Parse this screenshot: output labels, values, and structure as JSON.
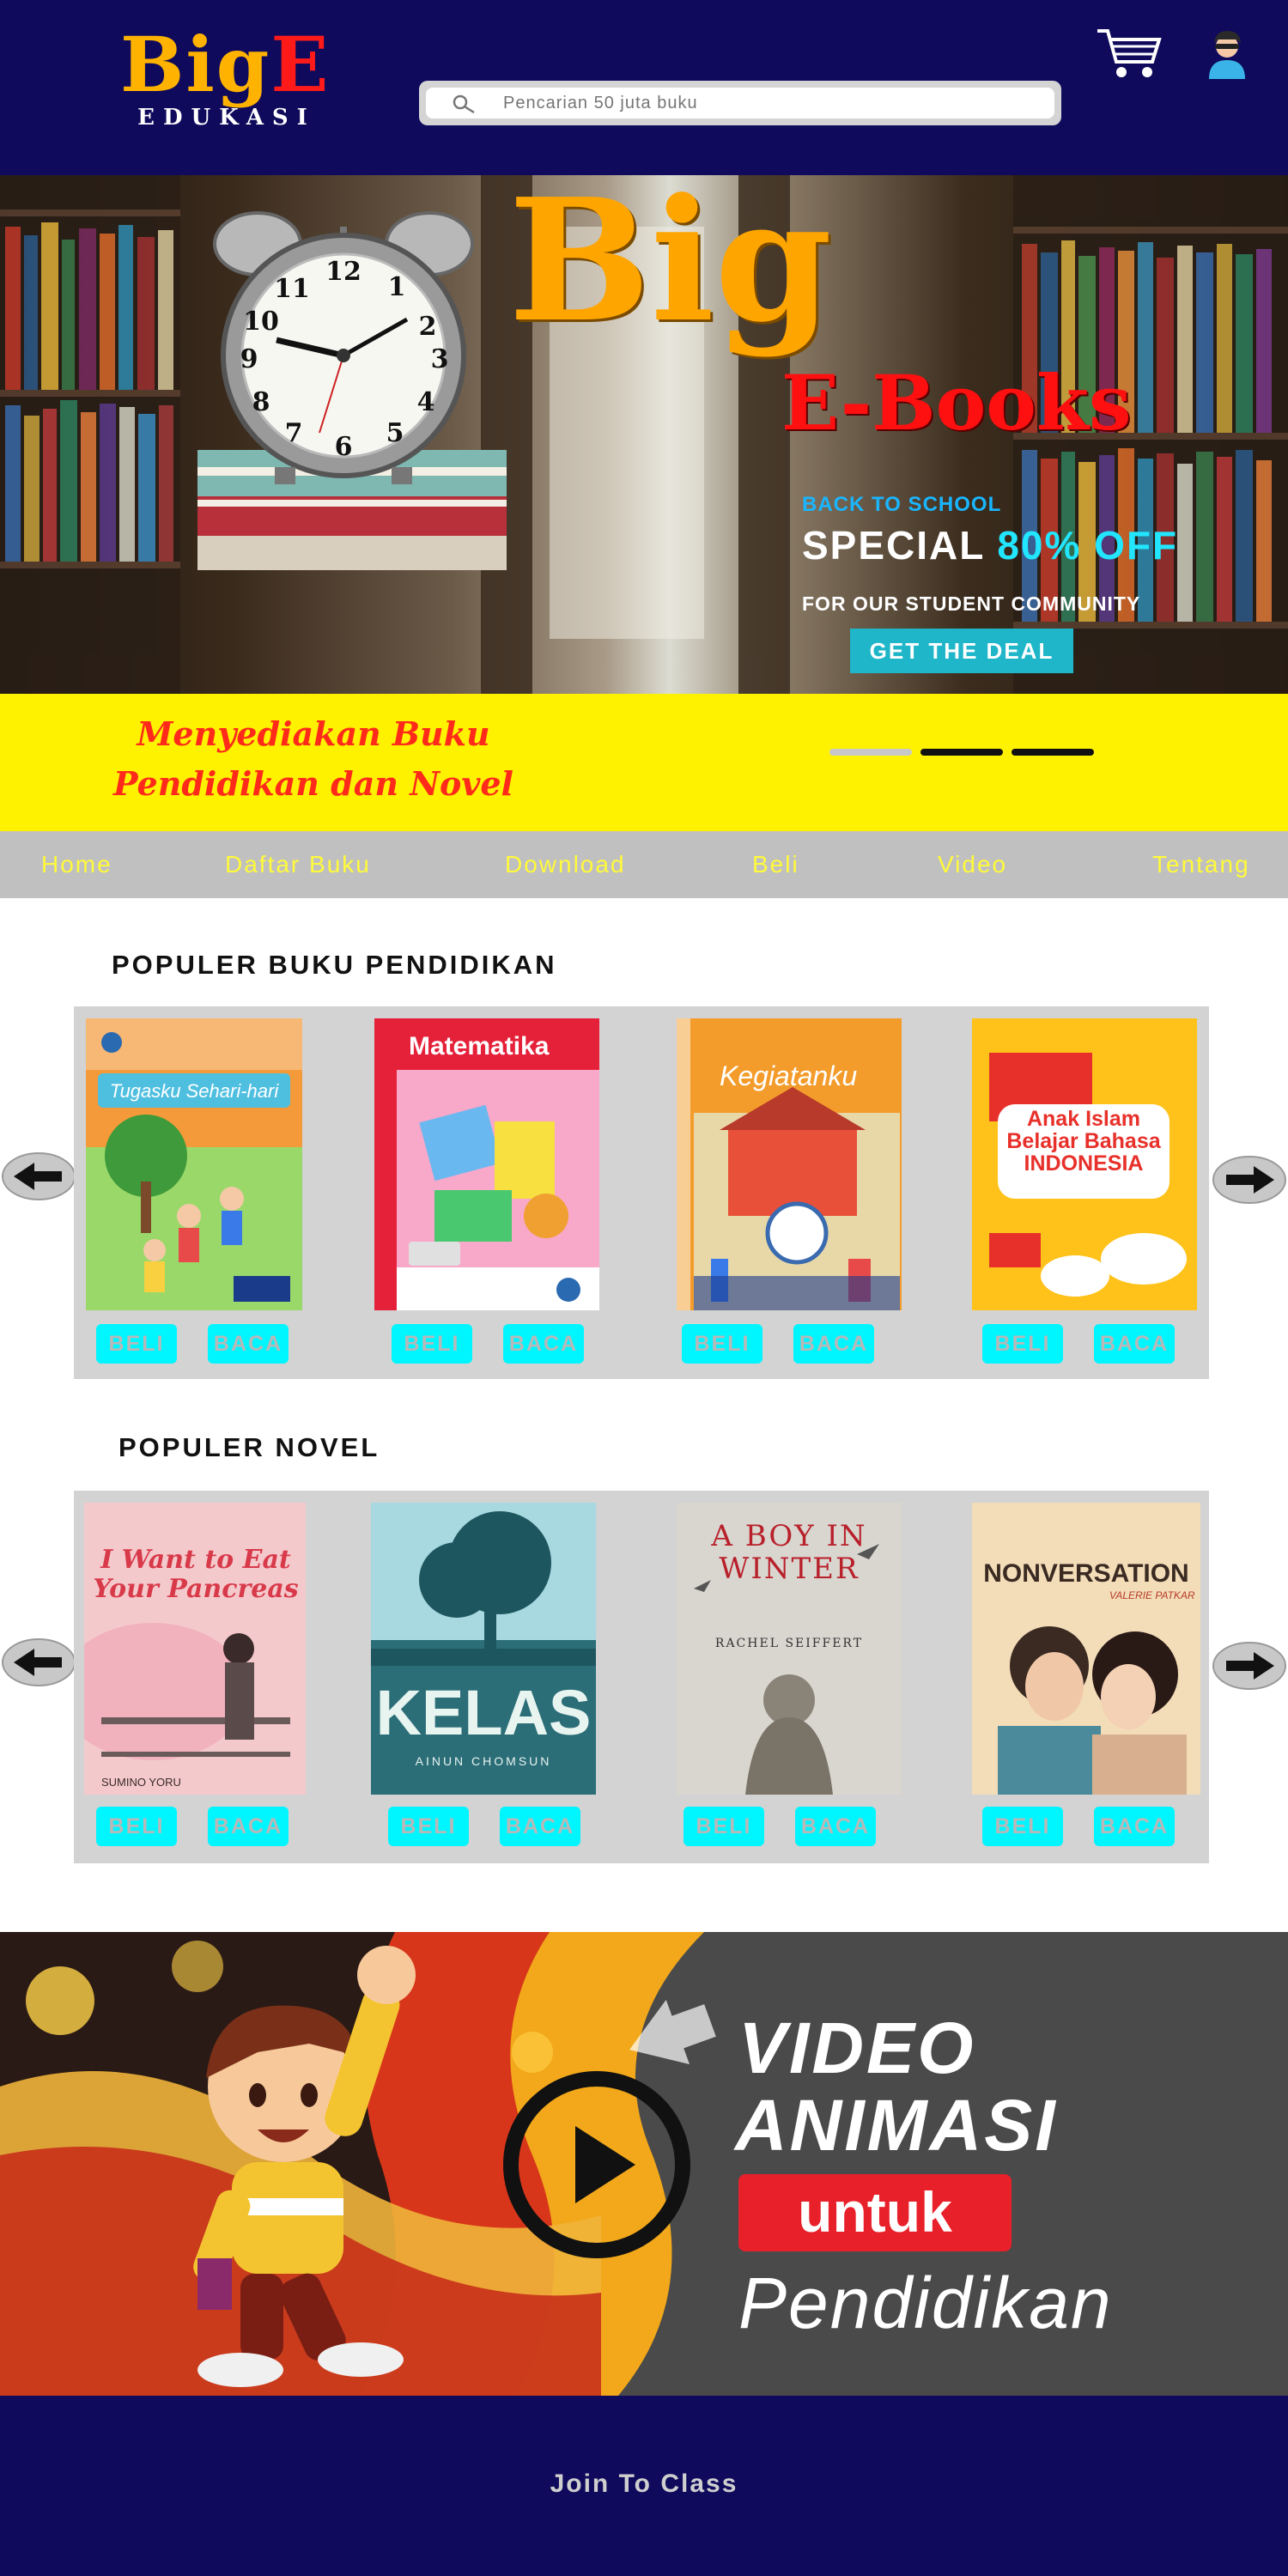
{
  "colors": {
    "header_bg": "#0f0a5c",
    "banner_bg": "#fff200",
    "nav_bg": "#c0c0c0",
    "nav_text": "#fffa3a",
    "button_bg": "#00f6ff",
    "button_text": "#b8b8b8",
    "deal_button": "#1eb6c8"
  },
  "header": {
    "logo_big_1": "Big",
    "logo_big_2": "E",
    "logo_sub": "EDUKASI",
    "search_placeholder": "Pencarian 50 juta buku",
    "search_icon": "search-icon",
    "cart_icon": "cart-icon",
    "user_icon": "user-avatar-icon"
  },
  "hero": {
    "title": "Big",
    "subtitle": "E-Books",
    "kicker": "BACK TO SCHOOL",
    "special_1": "SPECIAL",
    "special_2": "80% OFF",
    "community": "FOR OUR STUDENT COMMUNITY",
    "cta": "GET THE DEAL"
  },
  "banner": {
    "tagline_line1": "Menyediakan Buku",
    "tagline_line2": "Pendidikan dan Novel",
    "slides_total": 3,
    "slide_active": 1
  },
  "nav": {
    "items": [
      {
        "label": "Home"
      },
      {
        "label": "Daftar Buku"
      },
      {
        "label": "Download"
      },
      {
        "label": "Beli"
      },
      {
        "label": "Video"
      },
      {
        "label": "Tentang"
      }
    ]
  },
  "pendidikan": {
    "title": "POPULER BUKU PENDIDIKAN",
    "books": [
      {
        "cover_title": "Tugasku Sehari-hari",
        "cover_color": "#f59a3a",
        "buy": "BELI",
        "read": "BACA"
      },
      {
        "cover_title": "Matematika",
        "cover_color": "#e5213a",
        "buy": "BELI",
        "read": "BACA"
      },
      {
        "cover_title": "Kegiatanku",
        "cover_color": "#f39c2b",
        "buy": "BELI",
        "read": "BACA"
      },
      {
        "cover_title": "Anak Islam Belajar Bahasa INDONESIA",
        "cover_color": "#ffc21a",
        "buy": "BELI",
        "read": "BACA"
      }
    ]
  },
  "novel": {
    "title": "POPULER NOVEL",
    "books": [
      {
        "cover_title": "I Want to Eat Your Pancreas",
        "author": "SUMINO YORU",
        "cover_color": "#f4c9cc",
        "buy": "BELI",
        "read": "BACA"
      },
      {
        "cover_title": "KELAS",
        "author": "AINUN CHOMSUN",
        "cover_color": "#2b6e78",
        "buy": "BELI",
        "read": "BACA"
      },
      {
        "cover_title": "A BOY IN WINTER",
        "author": "RACHEL SEIFFERT",
        "cover_color": "#d9d6d0",
        "buy": "BELI",
        "read": "BACA"
      },
      {
        "cover_title": "NONVERSATION",
        "author": "VALERIE PATKAR",
        "cover_color": "#f3ddb8",
        "buy": "BELI",
        "read": "BACA"
      }
    ]
  },
  "video": {
    "line1": "VIDEO",
    "line2": "ANIMASI",
    "line3": "untuk",
    "line4": "Pendidikan",
    "play_icon": "play-icon"
  },
  "footer": {
    "join": "Join To Class"
  }
}
